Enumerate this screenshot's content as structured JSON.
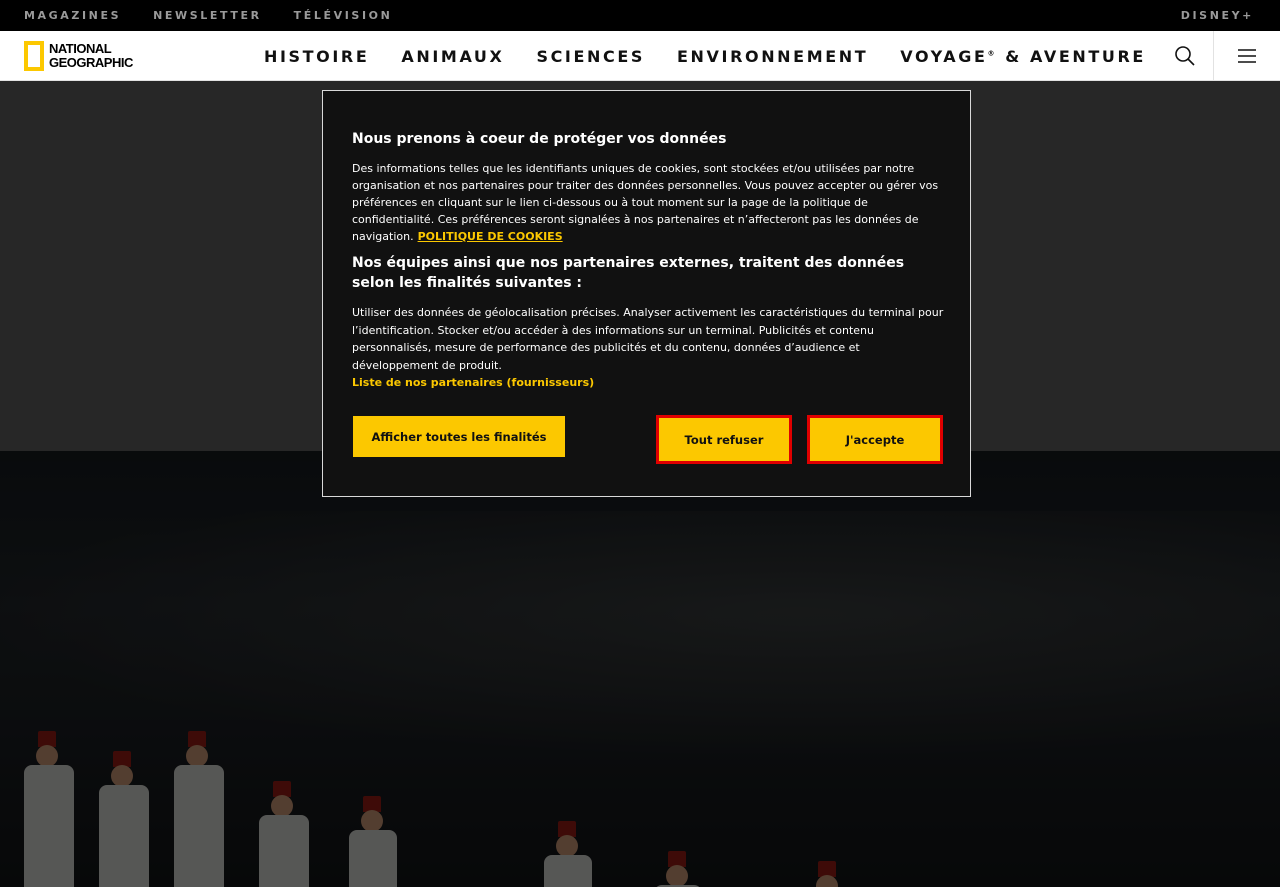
{
  "topbar": {
    "links": [
      "MAGAZINES",
      "NEWSLETTER",
      "TÉLÉVISION"
    ],
    "disney": "DISNEY+"
  },
  "brand": {
    "line1": "NATIONAL",
    "line2": "GEOGRAPHIC",
    "accent": "#fcc800"
  },
  "nav": {
    "items": [
      "HISTOIRE",
      "ANIMAUX",
      "SCIENCES",
      "ENVIRONNEMENT"
    ],
    "voyage": "VOYAGE",
    "voyage_mark": "®",
    "voyage_rest": " & AVENTURE",
    "search_icon": "search-icon",
    "menu_icon": "hamburger-menu-icon"
  },
  "cookie": {
    "title": "Nous prenons à coeur de protéger vos données",
    "description": "Des informations telles que les identifiants uniques de cookies, sont stockées et/ou utilisées par notre organisation et nos partenaires pour traiter des données personnelles. Vous pouvez accepter ou gérer vos préférences en cliquant sur le lien ci-dessous ou à tout moment sur la page de la politique de confidentialité. Ces préférences seront signalées à nos partenaires et n’affecteront pas les données de navigation.",
    "policy_link": "POLITIQUE DE COOKIES",
    "subtitle": "Nos équipes ainsi que nos partenaires externes, traitent des données selon les finalités suivantes :",
    "purposes": "Utiliser des données de géolocalisation précises. Analyser activement les caractéristiques du terminal pour l’identification. Stocker et/ou accéder à des informations sur un terminal. Publicités et contenu personnalisés, mesure de performance des publicités et du contenu, données d’audience et développement de produit.",
    "partners_link": "Liste de nos partenaires (fournisseurs)",
    "settings_button": "Afficher toutes les finalités",
    "reject_button": "Tout refuser",
    "accept_button": "J'accepte",
    "button_color": "#fcc800",
    "highlight_color": "#e00000"
  }
}
